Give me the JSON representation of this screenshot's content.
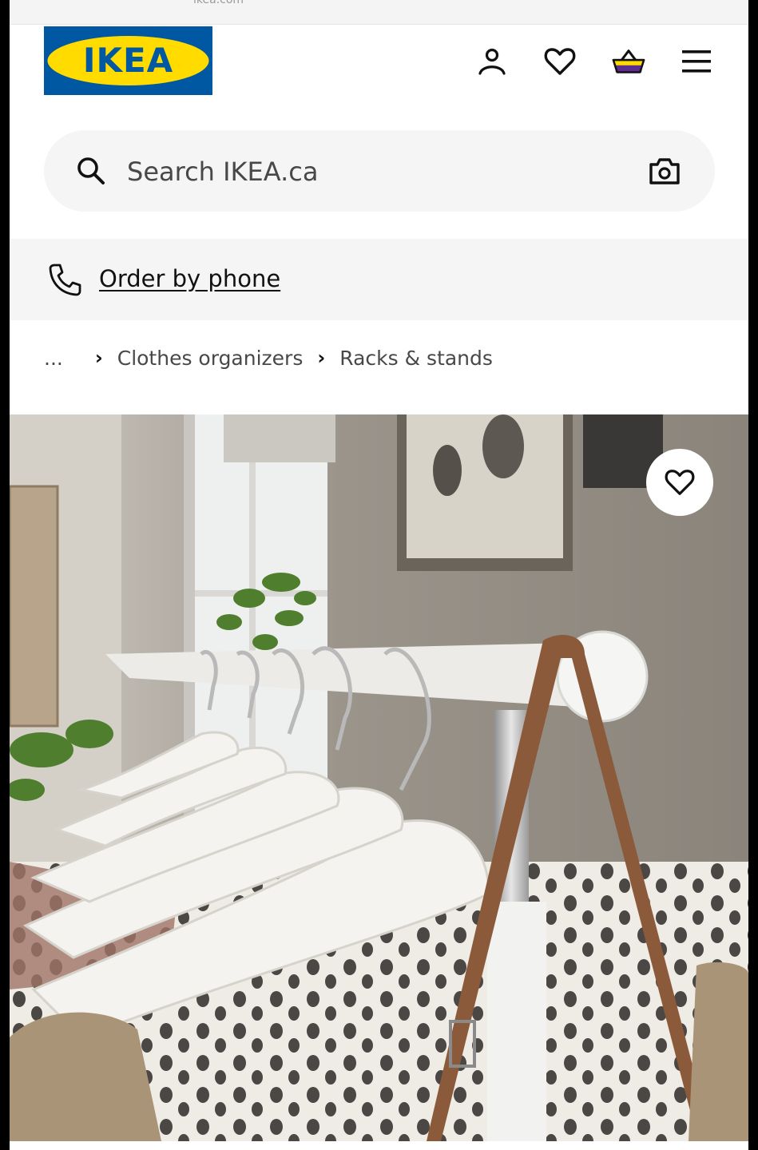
{
  "browser": {
    "url": "ikea.com"
  },
  "header": {
    "logo_text": "IKEA",
    "brand_colors": {
      "blue": "#0058a3",
      "yellow": "#ffdb00"
    },
    "icons": [
      "user-icon",
      "heart-icon",
      "cart-icon",
      "menu-icon"
    ]
  },
  "search": {
    "placeholder": "Search IKEA.ca"
  },
  "phone": {
    "label": "Order by phone"
  },
  "breadcrumb": {
    "ellipsis": "...",
    "items": [
      "Clothes organizers",
      "Racks & stands"
    ]
  }
}
